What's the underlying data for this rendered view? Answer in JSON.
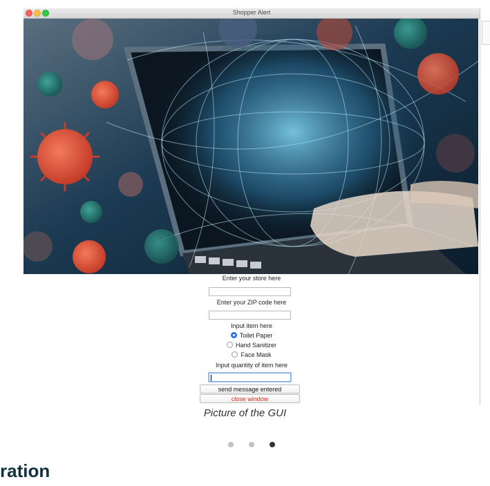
{
  "window": {
    "title": "Shopper Alert"
  },
  "form": {
    "store_label": "Enter your store here",
    "store_value": "",
    "zip_label": "Enter your ZIP code here",
    "zip_value": "",
    "item_label": "Input item here",
    "items": [
      {
        "label": "Toilet Paper",
        "selected": true
      },
      {
        "label": "Hand Sanitizer",
        "selected": false
      },
      {
        "label": "Face Mask",
        "selected": false
      }
    ],
    "quantity_label": "Input quantity of item here",
    "quantity_value": "",
    "send_button": "send message entered",
    "close_button": "close window"
  },
  "caption": "Picture of the GUI",
  "carousel": {
    "count": 3,
    "active_index": 2
  },
  "section_heading": "ration",
  "colors": {
    "close_text": "#e0261f",
    "radio_selected": "#3478f6",
    "heading": "#0f3140"
  }
}
